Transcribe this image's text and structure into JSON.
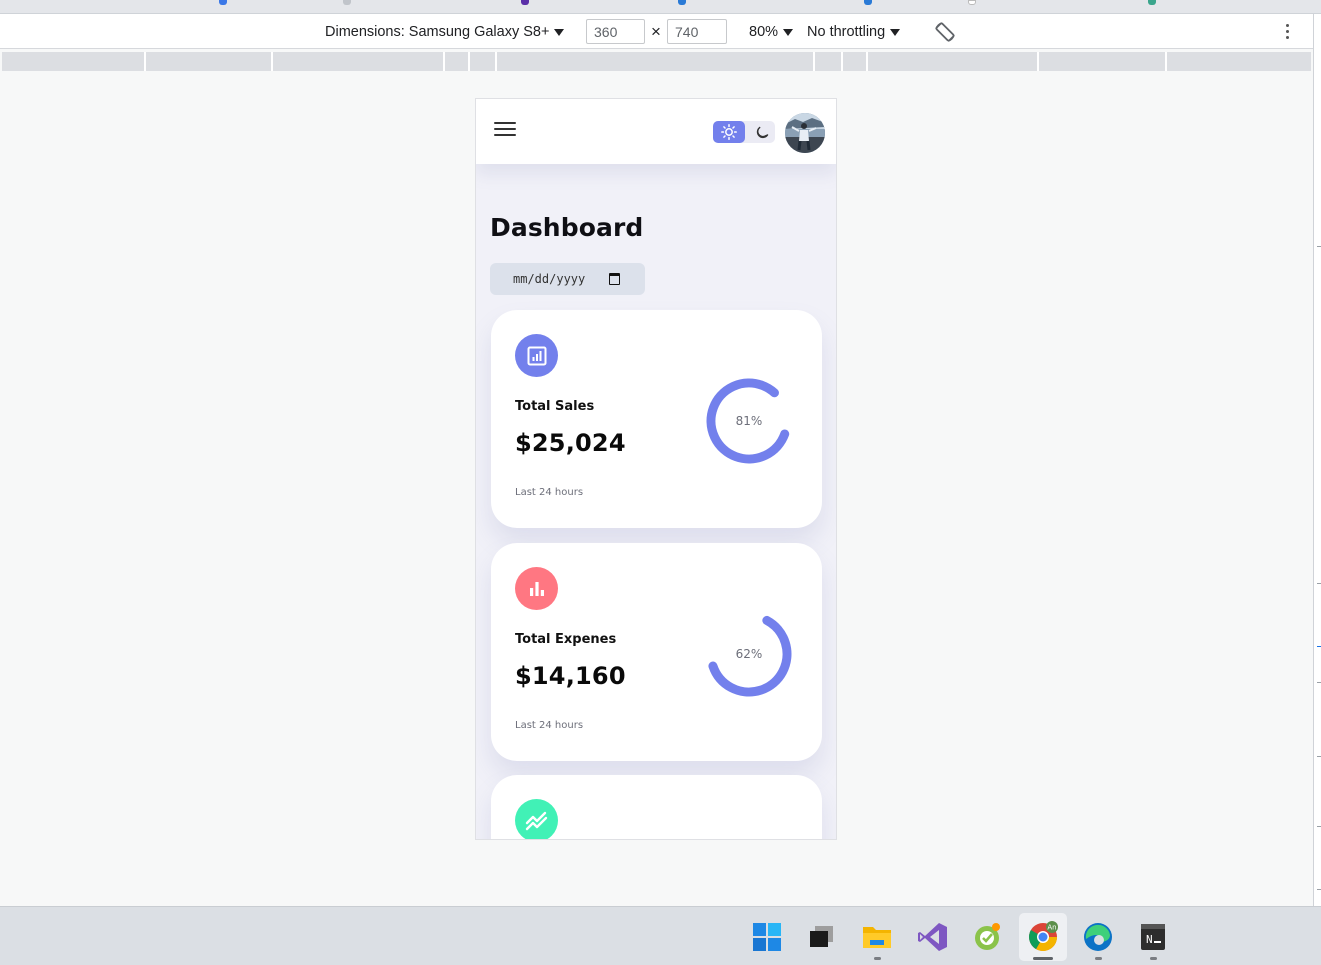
{
  "device_toolbar": {
    "dimensions_label": "Dimensions: Samsung Galaxy S8+",
    "width_value": "360",
    "height_value": "740",
    "times_symbol": "×",
    "zoom_label": "80%",
    "throttling_label": "No throttling",
    "rotate_icon": "rotate-icon",
    "more_icon": "more-vertical-icon"
  },
  "app": {
    "menu_icon": "hamburger-menu-icon",
    "theme_toggle": {
      "light_icon": "sun-icon",
      "dark_icon": "moon-icon",
      "active": "light"
    },
    "avatar": "profile-avatar",
    "page_title": "Dashboard",
    "date_input": {
      "placeholder": "mm/dd/yyyy",
      "icon": "calendar-icon"
    },
    "cards": [
      {
        "icon": "analytics-icon",
        "icon_color": "#7380ec",
        "label": "Total Sales",
        "value": "$25,024",
        "progress_text": "81%",
        "progress": 0.81,
        "ring_color": "#7380ec",
        "footer": "Last 24 hours"
      },
      {
        "icon": "bar-chart-icon",
        "icon_color": "#ff7782",
        "label": "Total Expenes",
        "value": "$14,160",
        "progress_text": "62%",
        "progress": 0.62,
        "ring_color": "#7380ec",
        "footer": "Last 24 hours"
      },
      {
        "icon": "stocks-icon",
        "icon_color": "#41f1b6"
      }
    ]
  },
  "taskbar": {
    "items": [
      "windows-start-icon",
      "task-view-icon",
      "file-explorer-icon",
      "visual-studio-icon",
      "app-icon",
      "chrome-icon",
      "edge-icon",
      "notepad-icon"
    ],
    "chrome_badge": "An"
  },
  "colors": {
    "primary": "#7380ec",
    "danger": "#ff7782",
    "success": "#41f1b6",
    "background": "#f1f1f8"
  }
}
